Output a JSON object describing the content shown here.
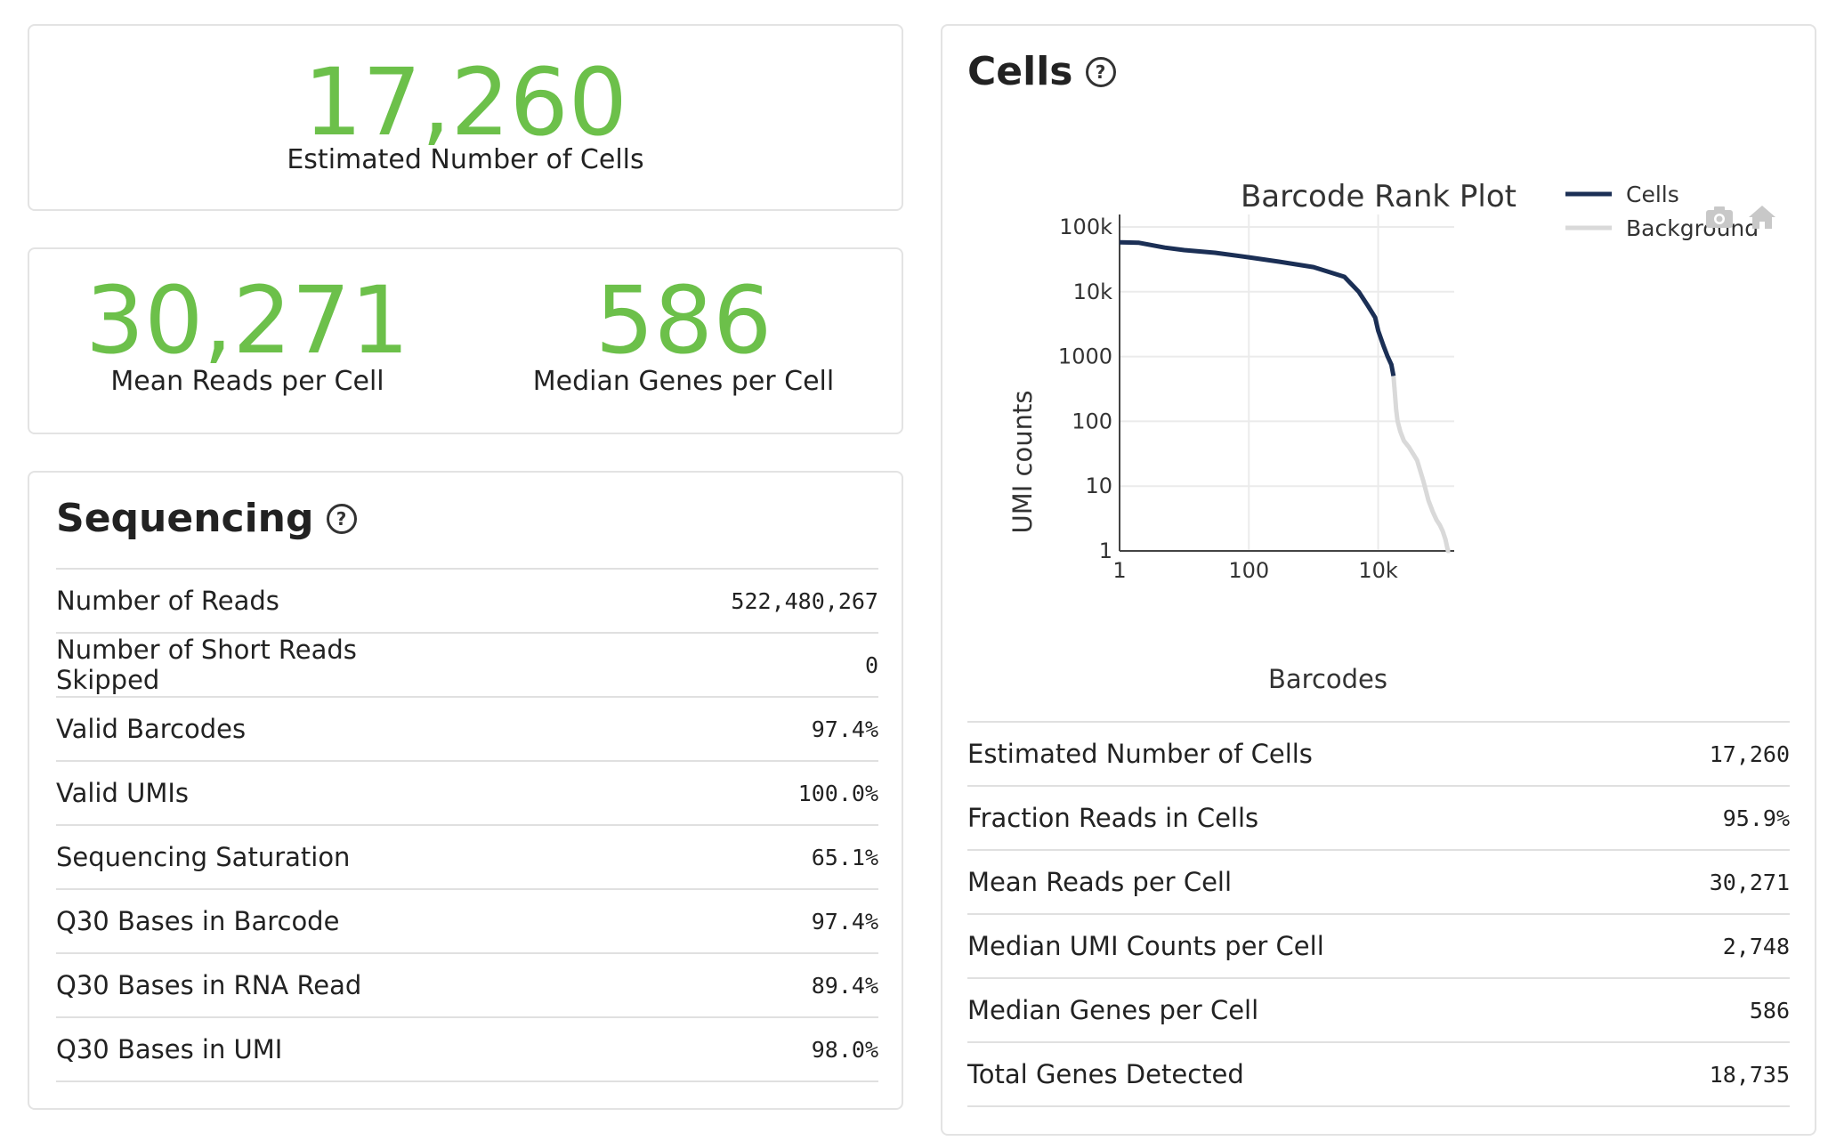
{
  "summary": {
    "estimated_cells_value": "17,260",
    "estimated_cells_label": "Estimated Number of Cells",
    "mean_reads_value": "30,271",
    "mean_reads_label": "Mean Reads per Cell",
    "median_genes_value": "586",
    "median_genes_label": "Median Genes per Cell"
  },
  "sequencing": {
    "title": "Sequencing",
    "help_glyph": "?",
    "rows": [
      {
        "label": "Number of Reads",
        "value": "522,480,267"
      },
      {
        "label": "Number of Short Reads Skipped",
        "value": "0"
      },
      {
        "label": "Valid Barcodes",
        "value": "97.4%"
      },
      {
        "label": "Valid UMIs",
        "value": "100.0%"
      },
      {
        "label": "Sequencing Saturation",
        "value": "65.1%"
      },
      {
        "label": "Q30 Bases in Barcode",
        "value": "97.4%"
      },
      {
        "label": "Q30 Bases in RNA Read",
        "value": "89.4%"
      },
      {
        "label": "Q30 Bases in UMI",
        "value": "98.0%"
      }
    ]
  },
  "cells": {
    "title": "Cells",
    "help_glyph": "?",
    "toolbar_icons": [
      "camera-icon",
      "home-icon"
    ],
    "rows": [
      {
        "label": "Estimated Number of Cells",
        "value": "17,260"
      },
      {
        "label": "Fraction Reads in Cells",
        "value": "95.9%"
      },
      {
        "label": "Mean Reads per Cell",
        "value": "30,271"
      },
      {
        "label": "Median UMI Counts per Cell",
        "value": "2,748"
      },
      {
        "label": "Median Genes per Cell",
        "value": "586"
      },
      {
        "label": "Total Genes Detected",
        "value": "18,735"
      }
    ]
  },
  "chart_data": {
    "type": "line",
    "title": "Barcode Rank Plot",
    "xlabel": "Barcodes",
    "ylabel": "UMI counts",
    "x_scale": "log",
    "y_scale": "log",
    "xlim": [
      1,
      150000
    ],
    "ylim": [
      1,
      100000
    ],
    "x_ticks": [
      {
        "value": 1,
        "label": "1"
      },
      {
        "value": 100,
        "label": "100"
      },
      {
        "value": 10000,
        "label": "10k"
      }
    ],
    "y_ticks": [
      {
        "value": 1,
        "label": "1"
      },
      {
        "value": 10,
        "label": "10"
      },
      {
        "value": 100,
        "label": "100"
      },
      {
        "value": 1000,
        "label": "1000"
      },
      {
        "value": 10000,
        "label": "10k"
      },
      {
        "value": 100000,
        "label": "100k"
      }
    ],
    "grid": true,
    "legend_position": "top-right",
    "series": [
      {
        "name": "Cells",
        "color": "#1b2f55",
        "x": [
          1,
          2,
          5,
          10,
          30,
          100,
          300,
          1000,
          3000,
          5000,
          7000,
          9000,
          10000,
          12000,
          14000,
          16000,
          17260
        ],
        "y": [
          58000,
          57000,
          48000,
          44000,
          40000,
          34000,
          29000,
          24000,
          17000,
          10000,
          6000,
          4000,
          2500,
          1500,
          1000,
          750,
          500
        ]
      },
      {
        "name": "Background",
        "color": "#d9d9d9",
        "x": [
          17260,
          18000,
          19000,
          20000,
          22000,
          25000,
          30000,
          40000,
          50000,
          60000,
          70000,
          80000,
          90000,
          100000,
          110000,
          120000,
          130000
        ],
        "y": [
          500,
          300,
          150,
          100,
          70,
          50,
          40,
          25,
          12,
          6,
          4,
          3,
          2.5,
          2,
          1.5,
          1,
          1
        ]
      }
    ]
  }
}
